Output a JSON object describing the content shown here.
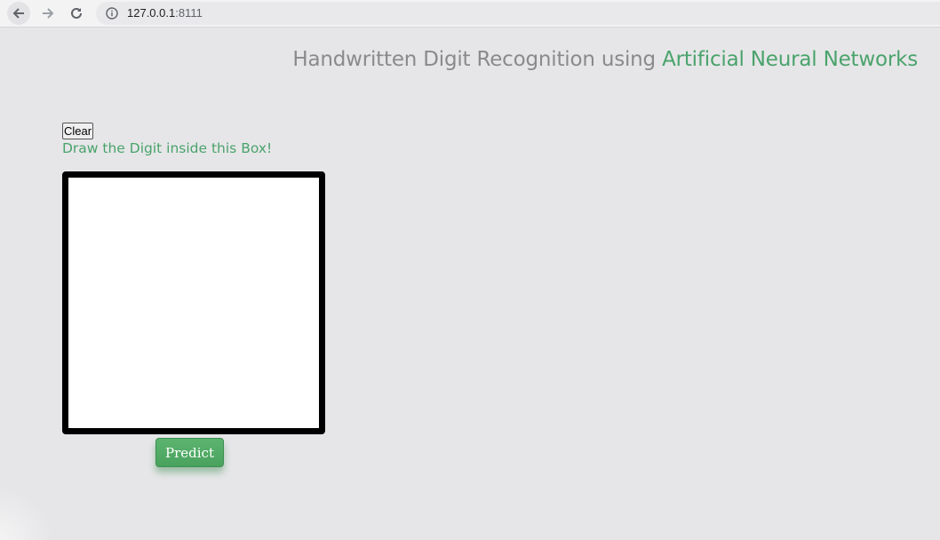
{
  "browser": {
    "url_host": "127.0.0.1",
    "url_port": ":8111",
    "icons": [
      "back-arrow-icon",
      "forward-arrow-icon",
      "reload-icon",
      "info-icon"
    ]
  },
  "header": {
    "title_prefix": "Handwritten Digit Recognition using ",
    "title_accent": "Artificial Neural Networks"
  },
  "controls": {
    "clear_label": "Clear",
    "instruction": "Draw the Digit inside this Box!",
    "predict_label": "Predict"
  },
  "colors": {
    "accent": "#4aa36c",
    "background": "#e6e6e8",
    "canvas_border": "#000000",
    "button_green": "#55ae68"
  }
}
